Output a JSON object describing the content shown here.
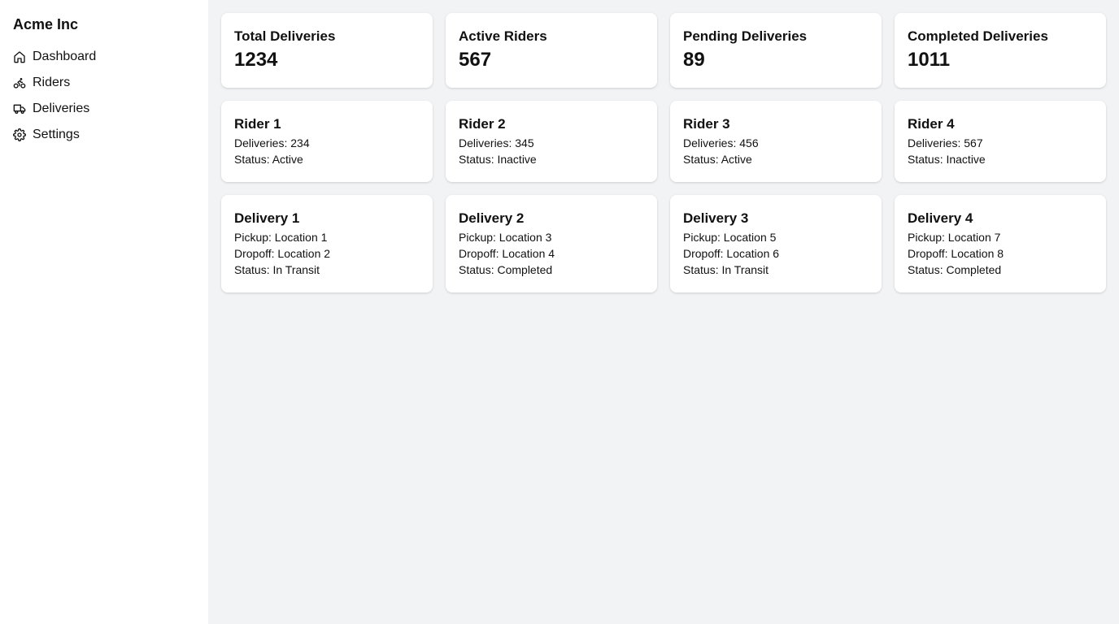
{
  "sidebar": {
    "brand": "Acme Inc",
    "items": [
      {
        "label": "Dashboard",
        "icon": "home-icon"
      },
      {
        "label": "Riders",
        "icon": "bike-icon"
      },
      {
        "label": "Deliveries",
        "icon": "truck-icon"
      },
      {
        "label": "Settings",
        "icon": "gear-icon"
      }
    ]
  },
  "stats": [
    {
      "title": "Total Deliveries",
      "value": "1234"
    },
    {
      "title": "Active Riders",
      "value": "567"
    },
    {
      "title": "Pending Deliveries",
      "value": "89"
    },
    {
      "title": "Completed Deliveries",
      "value": "1011"
    }
  ],
  "riders": [
    {
      "name": "Rider 1",
      "deliveries": "Deliveries: 234",
      "status": "Status: Active"
    },
    {
      "name": "Rider 2",
      "deliveries": "Deliveries: 345",
      "status": "Status: Inactive"
    },
    {
      "name": "Rider 3",
      "deliveries": "Deliveries: 456",
      "status": "Status: Active"
    },
    {
      "name": "Rider 4",
      "deliveries": "Deliveries: 567",
      "status": "Status: Inactive"
    }
  ],
  "deliveries": [
    {
      "name": "Delivery 1",
      "pickup": "Pickup: Location 1",
      "dropoff": "Dropoff: Location 2",
      "status": "Status: In Transit"
    },
    {
      "name": "Delivery 2",
      "pickup": "Pickup: Location 3",
      "dropoff": "Dropoff: Location 4",
      "status": "Status: Completed"
    },
    {
      "name": "Delivery 3",
      "pickup": "Pickup: Location 5",
      "dropoff": "Dropoff: Location 6",
      "status": "Status: In Transit"
    },
    {
      "name": "Delivery 4",
      "pickup": "Pickup: Location 7",
      "dropoff": "Dropoff: Location 8",
      "status": "Status: Completed"
    }
  ],
  "colors": {
    "background": "#f2f3f5",
    "card": "#ffffff",
    "text": "#111111"
  }
}
